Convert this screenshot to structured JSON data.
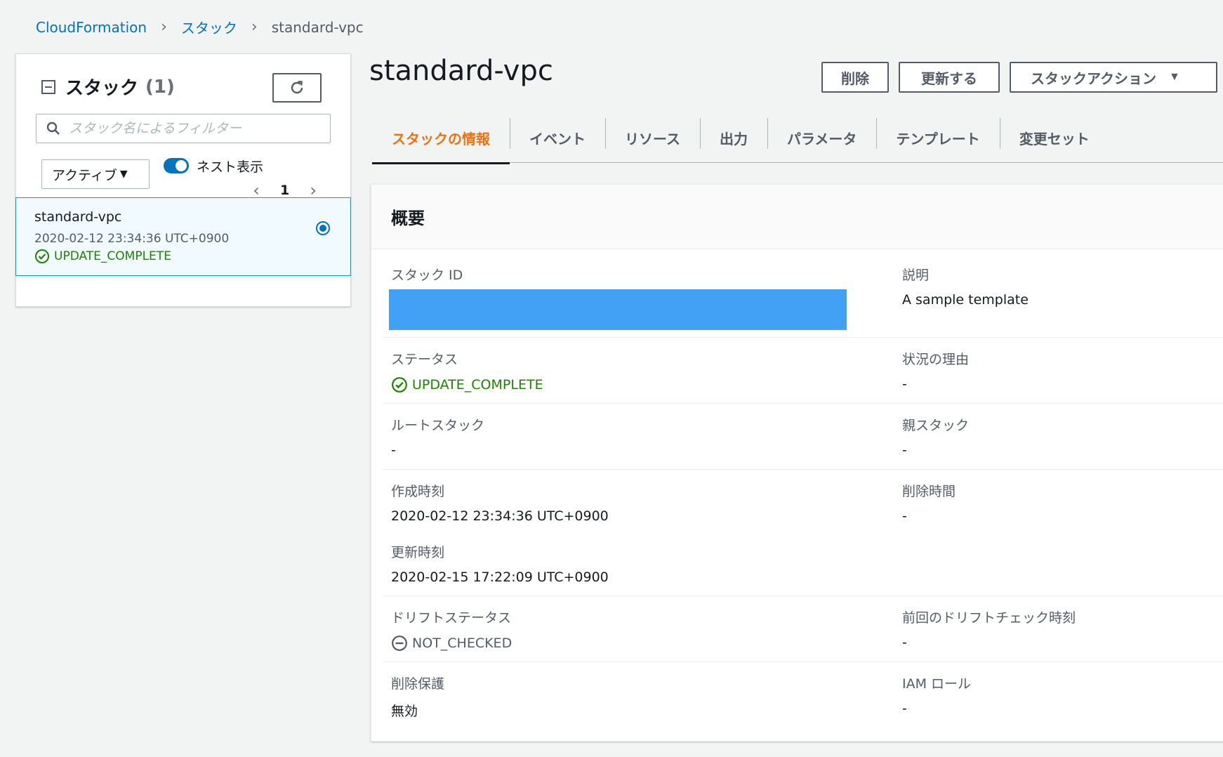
{
  "breadcrumb": {
    "items": [
      "CloudFormation",
      "スタック"
    ],
    "current": "standard-vpc"
  },
  "left_panel": {
    "title": "スタック",
    "count": "(1)",
    "search_placeholder": "スタック名によるフィルター",
    "status_filter": "アクティブ",
    "nested_toggle_label": "ネスト表示",
    "nested_toggle_on": true,
    "page_number": "1",
    "stacks": [
      {
        "name": "standard-vpc",
        "time": "2020-02-12 23:34:36 UTC+0900",
        "status": "UPDATE_COMPLETE",
        "selected": true
      }
    ]
  },
  "main": {
    "title": "standard-vpc",
    "buttons": {
      "delete": "削除",
      "update": "更新する",
      "actions": "スタックアクション"
    },
    "tabs": [
      "スタックの情報",
      "イベント",
      "リソース",
      "出力",
      "パラメータ",
      "テンプレート",
      "変更セット"
    ],
    "active_tab": "スタックの情報",
    "overview": {
      "title": "概要",
      "stack_id_label": "スタック ID",
      "description_label": "説明",
      "description": "A sample template",
      "status_label": "ステータス",
      "status": "UPDATE_COMPLETE",
      "status_reason_label": "状況の理由",
      "status_reason": "-",
      "root_stack_label": "ルートスタック",
      "root_stack": "-",
      "parent_stack_label": "親スタック",
      "parent_stack": "-",
      "created_label": "作成時刻",
      "created": "2020-02-12 23:34:36 UTC+0900",
      "deleted_label": "削除時間",
      "deleted": "-",
      "updated_label": "更新時刻",
      "updated": "2020-02-15 17:22:09 UTC+0900",
      "drift_label": "ドリフトステータス",
      "drift": "NOT_CHECKED",
      "last_drift_label": "前回のドリフトチェック時刻",
      "last_drift": "-",
      "termination_label": "削除保護",
      "termination": "無効",
      "iam_role_label": "IAM ロール",
      "iam_role": "-"
    }
  },
  "colors": {
    "link": "#0073bb",
    "success": "#1d8102",
    "active_tab": "#ec7211",
    "redacted": "#42a0f5",
    "selected_bg": "#f1faff"
  }
}
